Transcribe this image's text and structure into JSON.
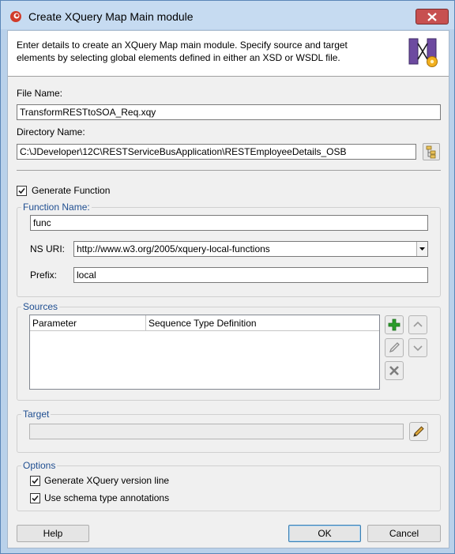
{
  "window": {
    "title": "Create XQuery Map Main module"
  },
  "header": {
    "description": "Enter details to create an XQuery Map main module. Specify source and target elements by selecting global elements defined in either an XSD or WSDL file."
  },
  "file": {
    "file_name_label": "File Name:",
    "file_name_value": "TransformRESTtoSOA_Req.xqy",
    "directory_label": "Directory Name:",
    "directory_value": "C:\\JDeveloper\\12C\\RESTServiceBusApplication\\RESTEmployeeDetails_OSB"
  },
  "function": {
    "generate_label": "Generate Function",
    "generate_checked": true,
    "group_title": "Function Name:",
    "name_value": "func",
    "ns_uri_label": "NS URI:",
    "ns_uri_value": "http://www.w3.org/2005/xquery-local-functions",
    "prefix_label": "Prefix:",
    "prefix_value": "local"
  },
  "sources": {
    "group_title": "Sources",
    "columns": [
      "Parameter",
      "Sequence Type Definition"
    ],
    "rows": []
  },
  "target": {
    "group_title": "Target",
    "value": ""
  },
  "options": {
    "group_title": "Options",
    "version_line_label": "Generate XQuery version line",
    "version_line_checked": true,
    "schema_annotations_label": "Use schema type annotations",
    "schema_annotations_checked": true
  },
  "buttons": {
    "help": "Help",
    "ok": "OK",
    "cancel": "Cancel"
  },
  "colors": {
    "title_bar": "#c6dbf1",
    "close_button": "#c75050",
    "group_title": "#1f4e91",
    "add_icon": "#2a9d2a"
  },
  "icons": [
    "app-logo-icon",
    "close-icon",
    "xquery-map-icon",
    "browse-folder-icon",
    "check-icon",
    "combo-arrow-icon",
    "add-icon",
    "edit-icon",
    "delete-icon",
    "move-up-icon",
    "move-down-icon",
    "pencil-icon"
  ]
}
